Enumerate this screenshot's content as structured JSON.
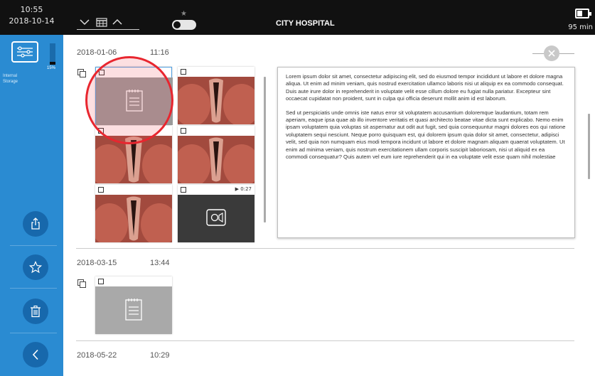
{
  "topbar": {
    "time": "10:55",
    "date": "2018-10-14",
    "title": "CITY HOSPITAL",
    "battery_remaining": "95 min"
  },
  "sidebar": {
    "storage_label_line1": "Internal",
    "storage_label_line2": "Storage",
    "storage_percent": "15%",
    "storage_level": 0.15,
    "buttons": [
      "export-icon",
      "star-icon",
      "trash-icon",
      "back-icon"
    ]
  },
  "sessions": [
    {
      "date": "2018-01-06",
      "time": "11:16",
      "items": [
        {
          "type": "note"
        },
        {
          "type": "image"
        },
        {
          "type": "image"
        },
        {
          "type": "image"
        },
        {
          "type": "image"
        },
        {
          "type": "video",
          "duration": "▶ 0:27"
        }
      ],
      "note_text": [
        "Lorem ipsum dolor sit amet, consectetur adipiscing elit, sed do eiusmod tempor incididunt ut labore et dolore magna aliqua. Ut enim ad minim veniam, quis nostrud exercitation ullamco laboris nisi ut aliquip ex ea commodo consequat. Duis aute irure dolor in reprehenderit in voluptate velit esse cillum dolore eu fugiat nulla pariatur. Excepteur sint occaecat cupidatat non proident, sunt in culpa qui officia deserunt mollit anim id est laborum.",
        "Sed ut perspiciatis unde omnis iste natus error sit voluptatem accusantium doloremque laudantium, totam rem aperiam, eaque ipsa quae ab illo inventore veritatis et quasi architecto beatae vitae dicta sunt explicabo. Nemo enim ipsam voluptatem quia voluptas sit aspernatur aut odit aut fugit, sed quia consequuntur magni dolores eos qui ratione voluptatem sequi nesciunt. Neque porro quisquam est, qui dolorem ipsum quia dolor sit amet, consectetur, adipisci velit, sed quia non numquam eius modi tempora incidunt ut labore et dolore magnam aliquam quaerat voluptatem. Ut enim ad minima veniam, quis nostrum exercitationem ullam corporis suscipit laboriosam, nisi ut aliquid ex ea commodi consequatur? Quis autem vel eum iure reprehenderit qui in ea voluptate velit esse quam nihil molestiae"
      ]
    },
    {
      "date": "2018-03-15",
      "time": "13:44",
      "items": [
        {
          "type": "note"
        }
      ]
    },
    {
      "date": "2018-05-22",
      "time": "10:29",
      "items": []
    }
  ],
  "colors": {
    "sidebar": "#2a8bd2",
    "sidebar_button": "#1768ac",
    "topbar": "#111111",
    "highlight": "#e8262f",
    "selection_border": "#4f9ee0"
  }
}
